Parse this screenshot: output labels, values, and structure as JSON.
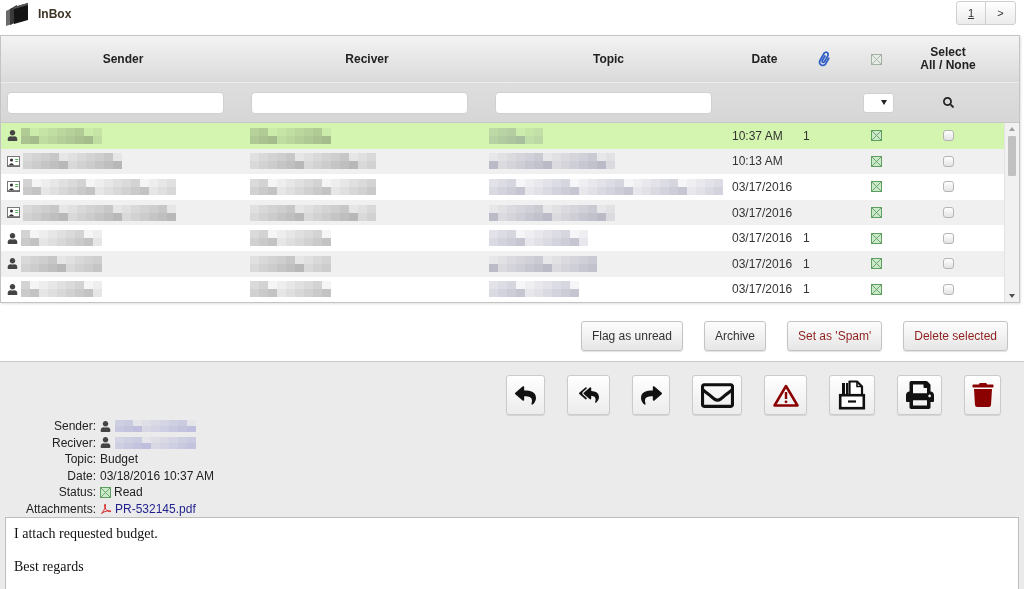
{
  "header": {
    "title": "InBox",
    "pagination": {
      "pages": [
        {
          "label": "1",
          "selected": true
        }
      ],
      "next": ">"
    }
  },
  "table": {
    "columns": [
      {
        "kind": "text",
        "label": "Sender",
        "filter": {
          "kind": "text"
        }
      },
      {
        "kind": "text",
        "label": "Reciver",
        "filter": {
          "kind": "text"
        }
      },
      {
        "kind": "text",
        "label": "Topic",
        "filter": {
          "kind": "text"
        }
      },
      {
        "kind": "text",
        "label": "Date"
      },
      {
        "kind": "attachment"
      },
      {
        "kind": "status",
        "filter": {
          "kind": "dropdown"
        }
      },
      {
        "kind": "select",
        "label": "Select",
        "link": "All / None",
        "filter": {
          "kind": "search"
        }
      }
    ],
    "rows": [
      {
        "selected": true,
        "sender": {
          "kind": "person"
        },
        "date": "10:37 AM",
        "attachments": "1",
        "read": true,
        "checked": false
      },
      {
        "selected": false,
        "sender": {
          "kind": "card"
        },
        "date": "10:13 AM",
        "read": true,
        "checked": false
      },
      {
        "selected": false,
        "sender": {
          "kind": "card"
        },
        "date": "03/17/2016",
        "read": true,
        "checked": false
      },
      {
        "selected": false,
        "sender": {
          "kind": "card"
        },
        "date": "03/17/2016",
        "read": true,
        "checked": false
      },
      {
        "selected": false,
        "sender": {
          "kind": "person"
        },
        "date": "03/17/2016",
        "attachments": "1",
        "read": true,
        "checked": false
      },
      {
        "selected": false,
        "sender": {
          "kind": "person"
        },
        "date": "03/17/2016",
        "attachments": "1",
        "read": true,
        "checked": false
      },
      {
        "selected": false,
        "sender": {
          "kind": "person"
        },
        "date": "03/17/2016",
        "attachments": "1",
        "read": true,
        "checked": false
      }
    ]
  },
  "actions": [
    {
      "label": "Flag as unread",
      "kind": "normal"
    },
    {
      "label": "Archive",
      "kind": "normal"
    },
    {
      "label": "Set as 'Spam'",
      "kind": "danger"
    },
    {
      "label": "Delete selected",
      "kind": "danger"
    }
  ],
  "toolbar": [
    {
      "kind": "reply"
    },
    {
      "kind": "reply_all"
    },
    {
      "kind": "forward"
    },
    {
      "kind": "envelope"
    },
    {
      "kind": "warning"
    },
    {
      "kind": "drawer"
    },
    {
      "kind": "print"
    },
    {
      "kind": "trash"
    }
  ],
  "message": {
    "fields": [
      {
        "label": "Sender:",
        "kind": "person"
      },
      {
        "label": "Reciver:",
        "kind": "person"
      },
      {
        "label": "Topic:",
        "kind": "text",
        "value": "Budget"
      },
      {
        "label": "Date:",
        "kind": "text",
        "value": "03/18/2016 10:37 AM"
      },
      {
        "label": "Status:",
        "kind": "status",
        "value": "Read"
      },
      {
        "label": "Attachments:",
        "kind": "file",
        "value": "PR-532145.pdf"
      }
    ],
    "body": [
      "I attach requested budget.",
      "Best regards"
    ]
  }
}
